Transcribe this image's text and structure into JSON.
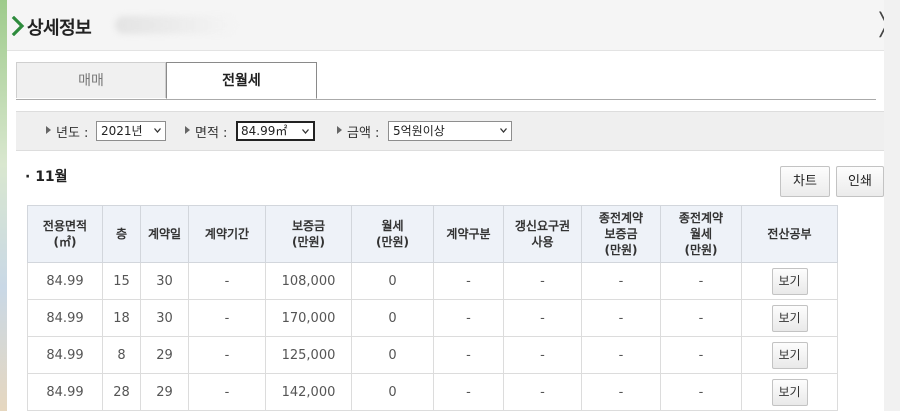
{
  "popup": {
    "title": "상세정보",
    "close_glyph": "╳"
  },
  "tabs": [
    {
      "label": "매매",
      "active": false
    },
    {
      "label": "전월세",
      "active": true
    }
  ],
  "filters": {
    "year": {
      "label": "년도 :",
      "value": "2021년"
    },
    "area": {
      "label": "면적 :",
      "value": "84.99㎡"
    },
    "amount": {
      "label": "금액 :",
      "value": "5억원이상"
    }
  },
  "month": "· 11월",
  "buttons": {
    "chart": "차트",
    "print": "인쇄"
  },
  "table": {
    "headers": [
      [
        "전용면적",
        "(㎡)"
      ],
      [
        "층"
      ],
      [
        "계약일"
      ],
      [
        "계약기간"
      ],
      [
        "보증금",
        "(만원)"
      ],
      [
        "월세",
        "(만원)"
      ],
      [
        "계약구분"
      ],
      [
        "갱신요구권",
        "사용"
      ],
      [
        "종전계약",
        "보증금",
        "(만원)"
      ],
      [
        "종전계약",
        "월세",
        "(만원)"
      ],
      [
        "전산공부"
      ]
    ],
    "rows": [
      [
        "84.99",
        "15",
        "30",
        "-",
        "108,000",
        "0",
        "-",
        "-",
        "-",
        "-"
      ],
      [
        "84.99",
        "18",
        "30",
        "-",
        "170,000",
        "0",
        "-",
        "-",
        "-",
        "-"
      ],
      [
        "84.99",
        "8",
        "29",
        "-",
        "125,000",
        "0",
        "-",
        "-",
        "-",
        "-"
      ],
      [
        "84.99",
        "28",
        "29",
        "-",
        "142,000",
        "0",
        "-",
        "-",
        "-",
        "-"
      ]
    ],
    "view_label": "보기"
  },
  "colors": {
    "accent_arrow": "#2e8b3d",
    "header_bg": "#eef2f8"
  },
  "icons": [
    "chevron-right-icon",
    "close-icon",
    "triangle-right-icon",
    "chevron-down-icon"
  ]
}
